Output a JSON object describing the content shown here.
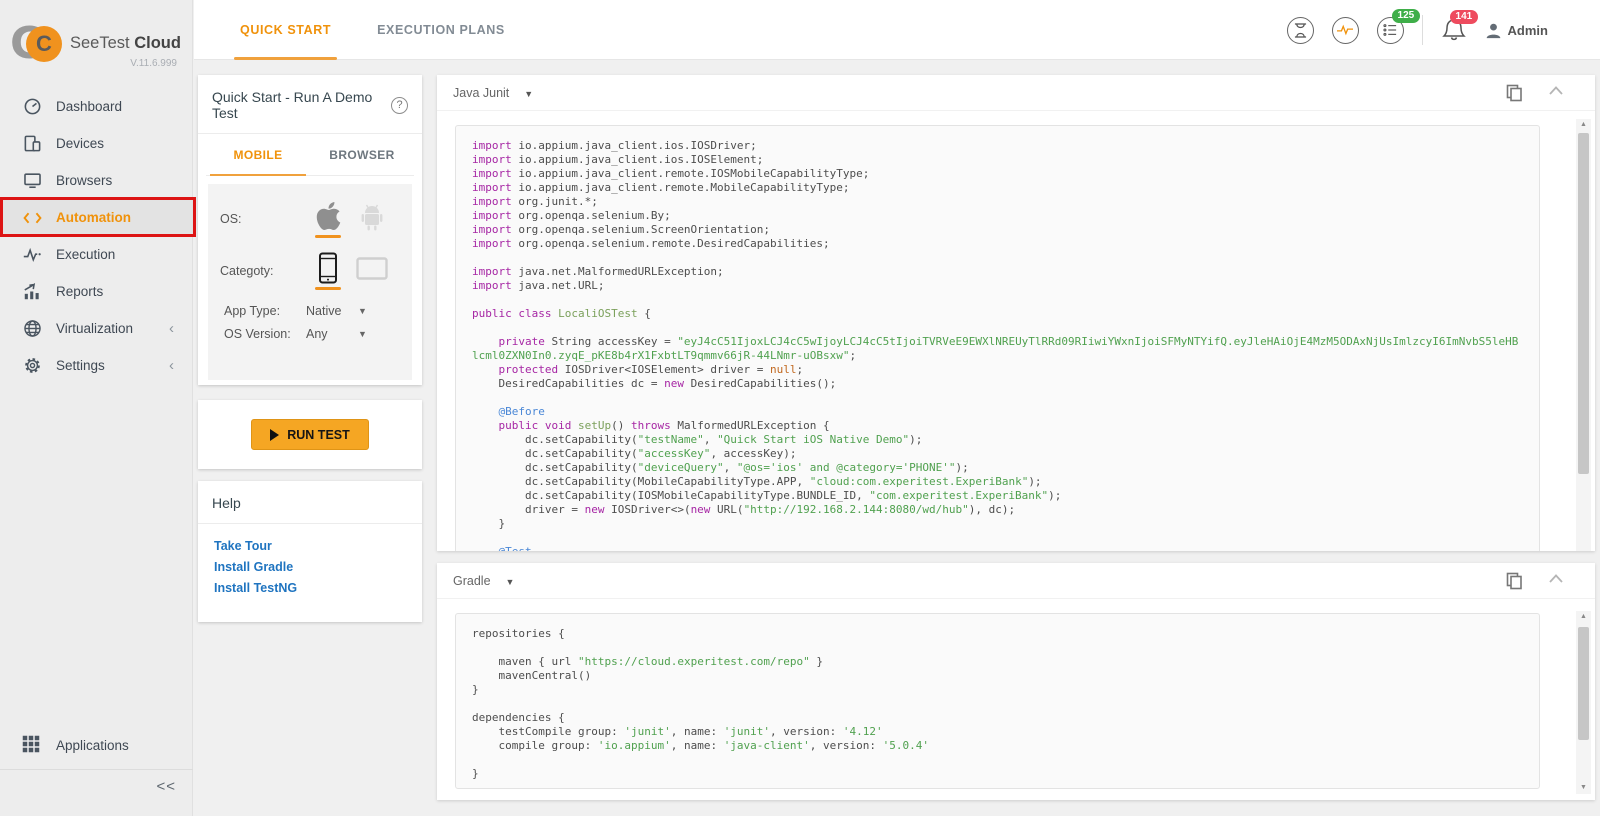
{
  "brand": {
    "name_regular": "SeeTest ",
    "name_bold": "Cloud",
    "version": "V.11.6.999"
  },
  "colors": {
    "accent_orange": "#f0920b",
    "button_orange": "#f5a623",
    "annotation_red": "#dd1414",
    "badge_green": "#3fae49",
    "badge_red": "#ee4b5e",
    "link_blue": "#1f74c0"
  },
  "sidebar": {
    "items": [
      {
        "label": "Dashboard",
        "icon": "dashboard-icon"
      },
      {
        "label": "Devices",
        "icon": "devices-icon"
      },
      {
        "label": "Browsers",
        "icon": "browsers-icon"
      },
      {
        "label": "Automation",
        "icon": "automation-icon",
        "active": true,
        "annotated": true
      },
      {
        "label": "Execution",
        "icon": "execution-icon"
      },
      {
        "label": "Reports",
        "icon": "reports-icon"
      },
      {
        "label": "Virtualization",
        "icon": "globe-icon",
        "chevron": "‹"
      },
      {
        "label": "Settings",
        "icon": "gear-icon",
        "chevron": "‹"
      }
    ],
    "applications_label": "Applications",
    "collapse_label": "<<"
  },
  "header": {
    "tabs": [
      {
        "label": "QUICK START",
        "active": true
      },
      {
        "label": "EXECUTION PLANS",
        "active": false
      }
    ],
    "tasks_badge": "125",
    "notifications_badge": "141",
    "user_label": "Admin"
  },
  "quick_start": {
    "title": "Quick Start - Run A Demo Test",
    "tabs": [
      {
        "label": "MOBILE",
        "active": true
      },
      {
        "label": "BROWSER",
        "active": false
      }
    ],
    "os_label": "OS:",
    "category_label": "Categoty:",
    "app_type_label": "App Type:",
    "app_type_value": "Native",
    "os_version_label": "OS Version:",
    "os_version_value": "Any",
    "run_button_label": "RUN TEST"
  },
  "help": {
    "title": "Help",
    "links": [
      "Take Tour",
      "Install Gradle",
      "Install TestNG"
    ]
  },
  "panels": [
    {
      "title": "Java Junit",
      "lines": [
        [
          [
            "k",
            "import"
          ],
          [
            "p",
            " io.appium.java_client.ios.IOSDriver;"
          ]
        ],
        [
          [
            "k",
            "import"
          ],
          [
            "p",
            " io.appium.java_client.ios.IOSElement;"
          ]
        ],
        [
          [
            "k",
            "import"
          ],
          [
            "p",
            " io.appium.java_client.remote.IOSMobileCapabilityType;"
          ]
        ],
        [
          [
            "k",
            "import"
          ],
          [
            "p",
            " io.appium.java_client.remote.MobileCapabilityType;"
          ]
        ],
        [
          [
            "k",
            "import"
          ],
          [
            "p",
            " org.junit.*;"
          ]
        ],
        [
          [
            "k",
            "import"
          ],
          [
            "p",
            " org.openqa.selenium.By;"
          ]
        ],
        [
          [
            "k",
            "import"
          ],
          [
            "p",
            " org.openqa.selenium.ScreenOrientation;"
          ]
        ],
        [
          [
            "k",
            "import"
          ],
          [
            "p",
            " org.openqa.selenium.remote.DesiredCapabilities;"
          ]
        ],
        [],
        [
          [
            "k",
            "import"
          ],
          [
            "p",
            " java.net.MalformedURLException;"
          ]
        ],
        [
          [
            "k",
            "import"
          ],
          [
            "p",
            " java.net.URL;"
          ]
        ],
        [],
        [
          [
            "k",
            "public class"
          ],
          [
            "p",
            " "
          ],
          [
            "t",
            "LocaliOSTest"
          ],
          [
            "p",
            " {"
          ]
        ],
        [],
        [
          [
            "p",
            "    "
          ],
          [
            "k",
            "private"
          ],
          [
            "p",
            " String accessKey = "
          ],
          [
            "s",
            "\"eyJ4cC51IjoxLCJ4cC5wIjoyLCJ4cC5tIjoiTVRVeE9EWXlNREUyTlRRd09RIiwiYWxnIjoiSFMyNTYifQ.eyJleHAiOjE4MzM5ODAxNjUsImlzcyI6ImNvbS5leHBlcml0ZXN0In0.zyqE_pKE8b4rX1FxbtLT9qmmv66jR-44LNmr-uOBsxw\""
          ],
          [
            "p",
            ";"
          ]
        ],
        [
          [
            "p",
            "    "
          ],
          [
            "k",
            "protected"
          ],
          [
            "p",
            " IOSDriver<IOSElement> driver = "
          ],
          [
            "n",
            "null"
          ],
          [
            "p",
            ";"
          ]
        ],
        [
          [
            "p",
            "    DesiredCapabilities dc = "
          ],
          [
            "k",
            "new"
          ],
          [
            "p",
            " DesiredCapabilities();"
          ]
        ],
        [],
        [
          [
            "p",
            "    "
          ],
          [
            "a",
            "@Before"
          ]
        ],
        [
          [
            "p",
            "    "
          ],
          [
            "k",
            "public void"
          ],
          [
            "p",
            " "
          ],
          [
            "t",
            "setUp"
          ],
          [
            "p",
            "() "
          ],
          [
            "k",
            "throws"
          ],
          [
            "p",
            " MalformedURLException {"
          ]
        ],
        [
          [
            "p",
            "        dc.setCapability("
          ],
          [
            "s",
            "\"testName\""
          ],
          [
            "p",
            ", "
          ],
          [
            "s",
            "\"Quick Start iOS Native Demo\""
          ],
          [
            "p",
            ");"
          ]
        ],
        [
          [
            "p",
            "        dc.setCapability("
          ],
          [
            "s",
            "\"accessKey\""
          ],
          [
            "p",
            ", accessKey);"
          ]
        ],
        [
          [
            "p",
            "        dc.setCapability("
          ],
          [
            "s",
            "\"deviceQuery\""
          ],
          [
            "p",
            ", "
          ],
          [
            "s",
            "\"@os='ios' and @category='PHONE'\""
          ],
          [
            "p",
            ");"
          ]
        ],
        [
          [
            "p",
            "        dc.setCapability(MobileCapabilityType.APP, "
          ],
          [
            "s",
            "\"cloud:com.experitest.ExperiBank\""
          ],
          [
            "p",
            ");"
          ]
        ],
        [
          [
            "p",
            "        dc.setCapability(IOSMobileCapabilityType.BUNDLE_ID, "
          ],
          [
            "s",
            "\"com.experitest.ExperiBank\""
          ],
          [
            "p",
            ");"
          ]
        ],
        [
          [
            "p",
            "        driver = "
          ],
          [
            "k",
            "new"
          ],
          [
            "p",
            " IOSDriver<>("
          ],
          [
            "k",
            "new"
          ],
          [
            "p",
            " URL("
          ],
          [
            "s",
            "\"http://192.168.2.144:8080/wd/hub\""
          ],
          [
            "p",
            "), dc);"
          ]
        ],
        [
          [
            "p",
            "    }"
          ]
        ],
        [],
        [
          [
            "p",
            "    "
          ],
          [
            "a",
            "@Test"
          ]
        ]
      ]
    },
    {
      "title": "Gradle",
      "lines": [
        [
          [
            "p",
            "repositories {"
          ]
        ],
        [],
        [
          [
            "p",
            "    maven { url "
          ],
          [
            "s",
            "\"https://cloud.experitest.com/repo\""
          ],
          [
            "p",
            " }"
          ]
        ],
        [
          [
            "p",
            "    mavenCentral()"
          ]
        ],
        [
          [
            "p",
            "}"
          ]
        ],
        [],
        [
          [
            "p",
            "dependencies {"
          ]
        ],
        [
          [
            "p",
            "    testCompile group: "
          ],
          [
            "s",
            "'junit'"
          ],
          [
            "p",
            ", name: "
          ],
          [
            "s",
            "'junit'"
          ],
          [
            "p",
            ", version: "
          ],
          [
            "s",
            "'4.12'"
          ]
        ],
        [
          [
            "p",
            "    compile group: "
          ],
          [
            "s",
            "'io.appium'"
          ],
          [
            "p",
            ", name: "
          ],
          [
            "s",
            "'java-client'"
          ],
          [
            "p",
            ", version: "
          ],
          [
            "s",
            "'5.0.4'"
          ]
        ],
        [],
        [
          [
            "p",
            "}"
          ]
        ]
      ]
    }
  ]
}
